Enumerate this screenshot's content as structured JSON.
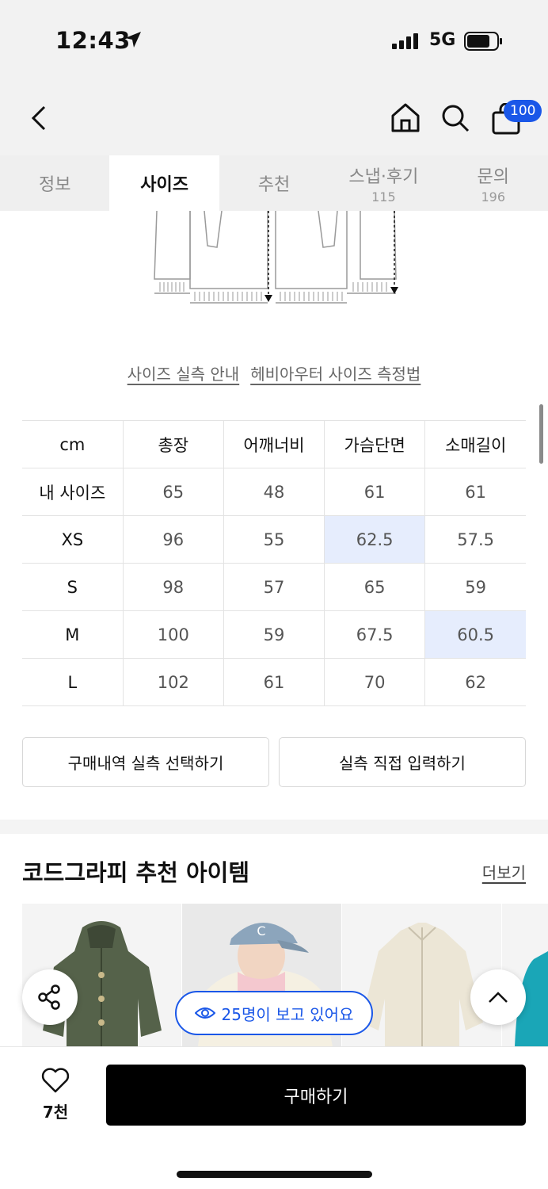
{
  "status_bar": {
    "time": "12:43",
    "network": "5G"
  },
  "nav": {
    "cart_count": "100"
  },
  "tabs": [
    {
      "label": "정보",
      "count": ""
    },
    {
      "label": "사이즈",
      "count": ""
    },
    {
      "label": "추천",
      "count": ""
    },
    {
      "label": "스냅·후기",
      "count": "115"
    },
    {
      "label": "문의",
      "count": "196"
    }
  ],
  "size_links": {
    "guide": "사이즈 실측 안내",
    "method": "헤비아우터 사이즈 측정법"
  },
  "size_table": {
    "headers": [
      "cm",
      "총장",
      "어깨너비",
      "가슴단면",
      "소매길이"
    ],
    "rows": [
      [
        "내 사이즈",
        "65",
        "48",
        "61",
        "61"
      ],
      [
        "XS",
        "96",
        "55",
        "62.5",
        "57.5"
      ],
      [
        "S",
        "98",
        "57",
        "65",
        "59"
      ],
      [
        "M",
        "100",
        "59",
        "67.5",
        "60.5"
      ],
      [
        "L",
        "102",
        "61",
        "70",
        "62"
      ]
    ]
  },
  "actions": {
    "purchase_history": "구매내역 실측 선택하기",
    "manual_input": "실측 직접 입력하기"
  },
  "recommend": {
    "title": "코드그라피 추천 아이템",
    "more": "더보기"
  },
  "viewers": "25명이 보고 있어요",
  "bottom": {
    "like_count": "7천",
    "buy_label": "구매하기"
  },
  "colors": {
    "accent": "#1a57e8",
    "highlight": "#e6edfd"
  }
}
